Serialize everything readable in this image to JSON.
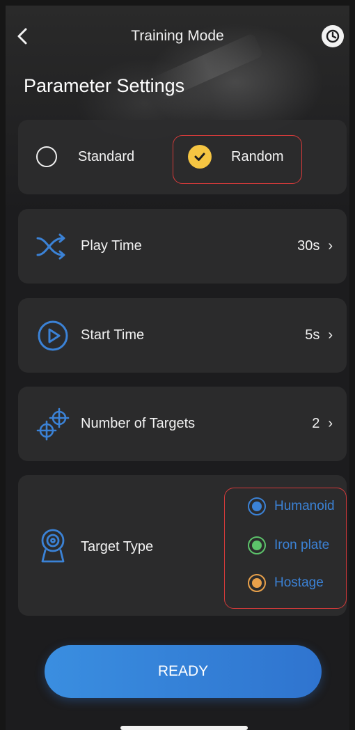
{
  "header": {
    "title": "Training Mode",
    "back_icon": "chevron-left-icon",
    "history_icon": "clock-icon"
  },
  "section_title": "Parameter Settings",
  "mode": {
    "options": [
      {
        "label": "Standard",
        "selected": false
      },
      {
        "label": "Random",
        "selected": true
      }
    ]
  },
  "settings": [
    {
      "icon": "shuffle-icon",
      "label": "Play Time",
      "value": "30s"
    },
    {
      "icon": "play-circle-icon",
      "label": "Start Time",
      "value": "5s"
    },
    {
      "icon": "crosshair-icon",
      "label": "Number of Targets",
      "value": "2"
    }
  ],
  "target_type": {
    "label": "Target Type",
    "icon": "target-stand-icon",
    "options": [
      {
        "label": "Humanoid",
        "color": "#3b82d6"
      },
      {
        "label": "Iron plate",
        "color": "#5cc26a"
      },
      {
        "label": "Hostage",
        "color": "#e8a04a"
      }
    ]
  },
  "ready_button": "READY",
  "colors": {
    "accent": "#3a8ee0",
    "selected_radio": "#f5c542",
    "highlight": "#d33a3a",
    "icon_blue": "#3b82d6"
  }
}
